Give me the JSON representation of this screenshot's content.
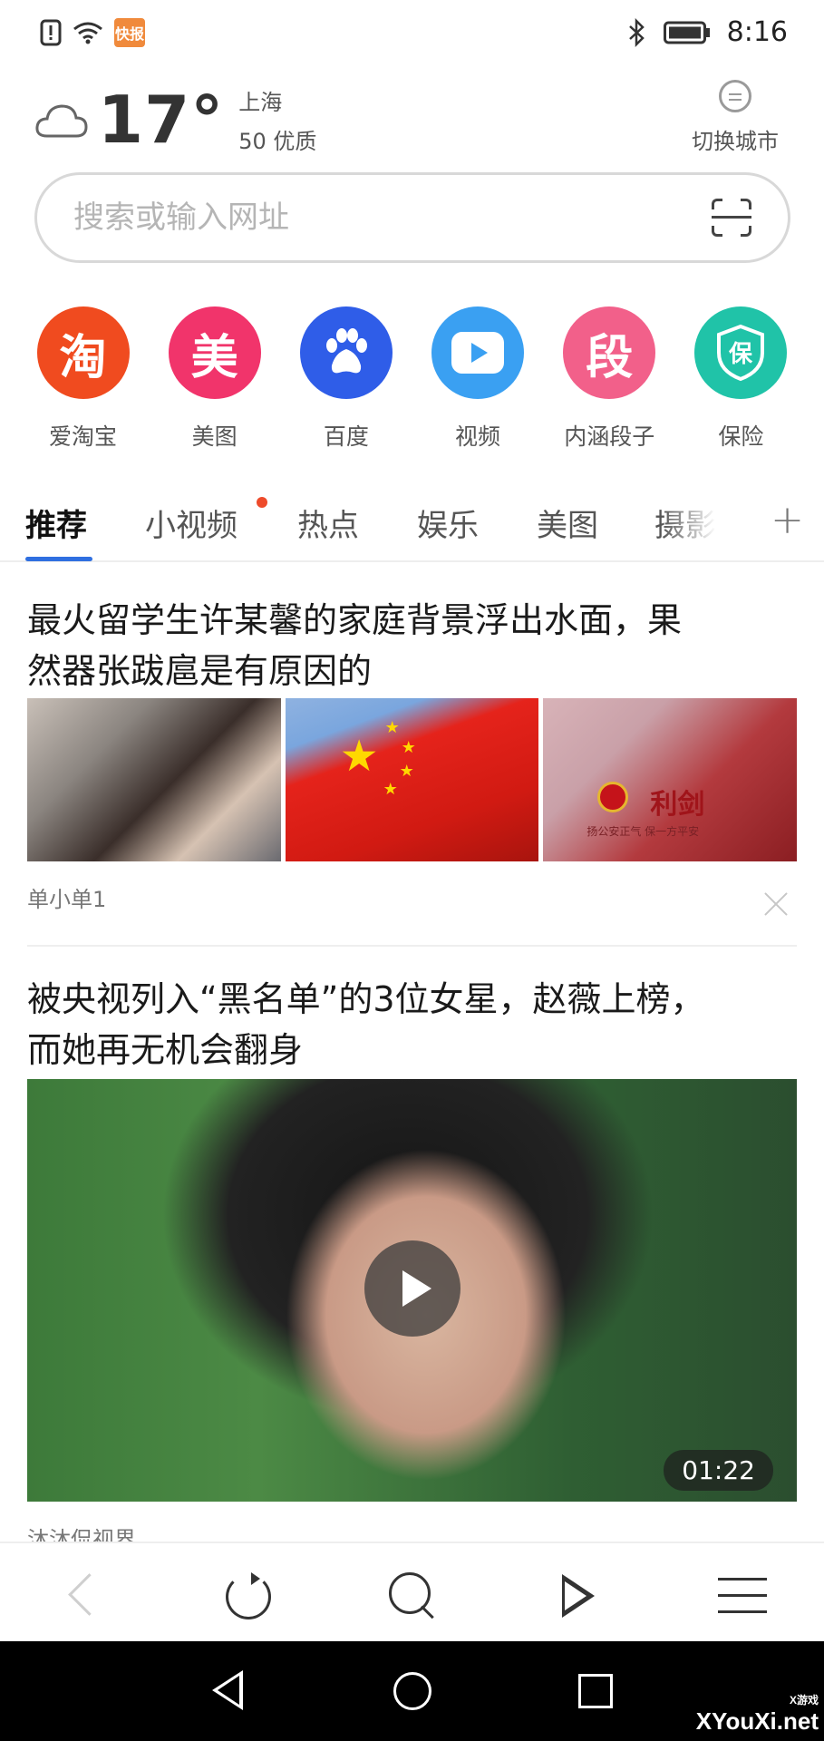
{
  "status_bar": {
    "time": "8:16",
    "app_badge": "快报"
  },
  "weather": {
    "temperature": "17°",
    "city": "上海",
    "air_quality": "50 优质",
    "switch_city_label": "切换城市"
  },
  "search": {
    "placeholder": "搜索或输入网址"
  },
  "shortcuts": [
    {
      "label": "爱淘宝",
      "glyph": "淘",
      "color": "#f04b1f"
    },
    {
      "label": "美图",
      "glyph": "美",
      "color": "#f1346b"
    },
    {
      "label": "百度",
      "glyph": "paw-icon",
      "color": "#2f5de8"
    },
    {
      "label": "视频",
      "glyph": "play-icon",
      "color": "#3aa0f2"
    },
    {
      "label": "内涵段子",
      "glyph": "段",
      "color": "#f2608a"
    },
    {
      "label": "保险",
      "glyph": "保",
      "color": "#20c3a8"
    }
  ],
  "tabs": [
    {
      "label": "推荐",
      "active": true
    },
    {
      "label": "小视频",
      "has_dot": true
    },
    {
      "label": "热点"
    },
    {
      "label": "娱乐"
    },
    {
      "label": "美图"
    },
    {
      "label": "摄影"
    }
  ],
  "feed": [
    {
      "title_line1": "最火留学生许某馨的家庭背景浮出水面，果",
      "title_line2": "然器张跋扈是有原因的",
      "source": "单小单1",
      "thumb3_text": "利剑",
      "thumb3_sub": "扬公安正气 保一方平安"
    },
    {
      "title_line1": "被央视列入“黑名单”的3位女星，赵薇上榜，",
      "title_line2": "而她再无机会翻身",
      "duration": "01:22",
      "source": "沐沐侃视界"
    }
  ],
  "watermark": {
    "site": "XYouXi.net",
    "small": "X游戏"
  }
}
